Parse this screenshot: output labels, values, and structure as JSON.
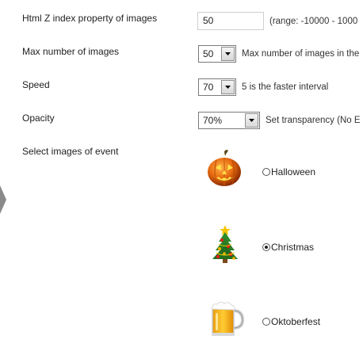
{
  "settings": {
    "zindex": {
      "label": "Html Z index property of images",
      "value": "50",
      "hint": "(range: -10000 - 1000"
    },
    "max_images": {
      "label": "Max number of images",
      "value": "50",
      "hint": "Max number of images in the"
    },
    "speed": {
      "label": "Speed",
      "value": "70",
      "hint": "5 is the faster interval"
    },
    "opacity": {
      "label": "Opacity",
      "value": "70%",
      "hint": "Set transparency (No E"
    },
    "events": {
      "label": "Select images of event",
      "options": [
        {
          "label": "Halloween",
          "checked": false,
          "icon": "pumpkin-icon"
        },
        {
          "label": "Christmas",
          "checked": true,
          "icon": "christmas-tree-icon"
        },
        {
          "label": "Oktoberfest",
          "checked": false,
          "icon": "beer-mug-icon"
        }
      ]
    }
  },
  "colors": {
    "border": "#cfcfcf",
    "select_border": "#7a7a7a",
    "text": "#222222"
  }
}
